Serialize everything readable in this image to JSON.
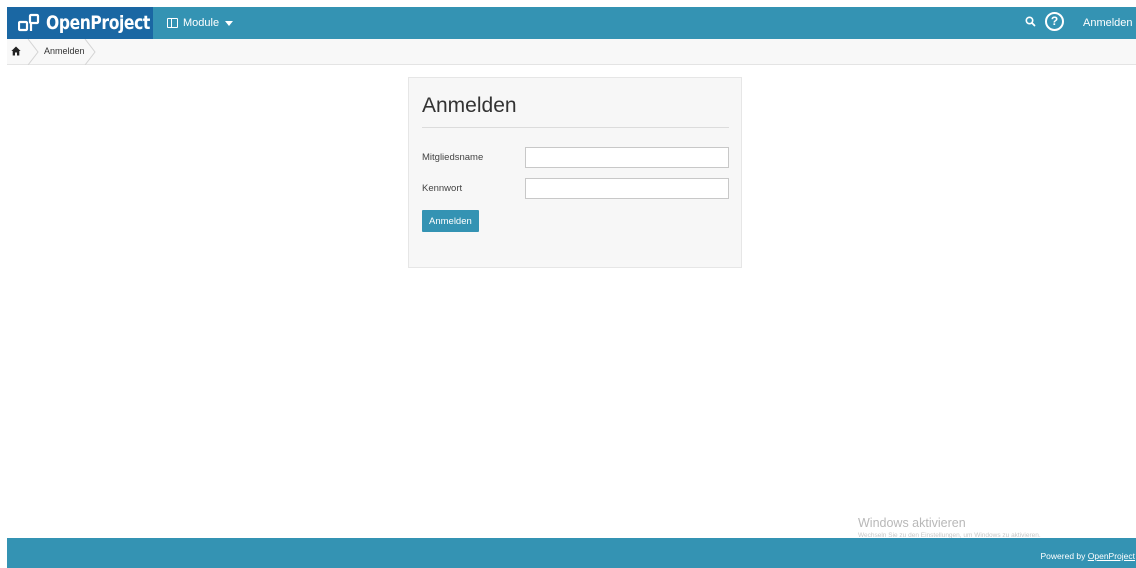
{
  "header": {
    "brand": "OpenProject",
    "module_menu_label": "Module",
    "login_menu_label": "Anmelden",
    "help_label": "?"
  },
  "breadcrumb": {
    "current": "Anmelden"
  },
  "login_form": {
    "title": "Anmelden",
    "username_label": "Mitgliedsname",
    "username_value": "",
    "password_label": "Kennwort",
    "password_value": "",
    "submit_label": "Anmelden"
  },
  "watermark": {
    "title": "Windows aktivieren",
    "subtitle": "Wechseln Sie zu den Einstellungen, um Windows zu aktivieren."
  },
  "footer": {
    "powered_prefix": "Powered by ",
    "powered_link": "OpenProject"
  },
  "colors": {
    "header": "#3493b3",
    "logo_background": "#1a67a3",
    "button": "#3493b3",
    "footer": "#3493b3"
  },
  "icons": {
    "logo": "openproject-logo-icon",
    "module": "modules-icon",
    "search": "search-icon",
    "help": "help-icon",
    "home": "home-icon",
    "dropdown": "chevron-down-icon"
  }
}
